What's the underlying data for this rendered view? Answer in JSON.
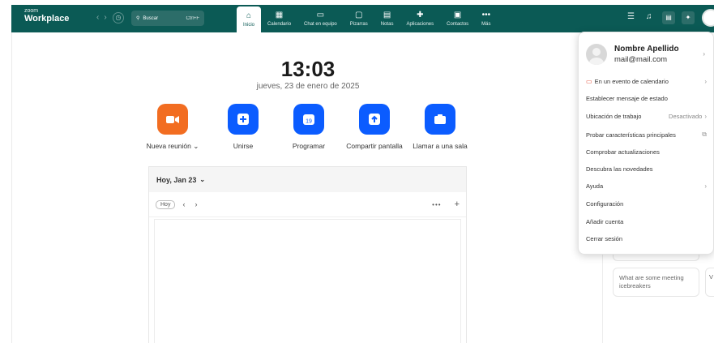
{
  "app": {
    "brand_small": "zoom",
    "brand": "Workplace"
  },
  "search": {
    "label": "Buscar",
    "shortcut": "Ctrl+F"
  },
  "tabs": [
    {
      "label": "Inicio",
      "icon": "home-icon",
      "glyph": "⌂"
    },
    {
      "label": "Calendario",
      "icon": "calendar-icon",
      "glyph": "▦"
    },
    {
      "label": "Chat en equipo",
      "icon": "chat-icon",
      "glyph": "▭"
    },
    {
      "label": "Pizarras",
      "icon": "whiteboard-icon",
      "glyph": "▢"
    },
    {
      "label": "Notas",
      "icon": "notes-icon",
      "glyph": "▤"
    },
    {
      "label": "Aplicaciones",
      "icon": "apps-icon",
      "glyph": "✚"
    },
    {
      "label": "Contactos",
      "icon": "contacts-icon",
      "glyph": "▣"
    },
    {
      "label": "Más",
      "icon": "more-icon",
      "glyph": "•••"
    }
  ],
  "clock": {
    "time": "13:03",
    "date": "jueves, 23 de enero de 2025"
  },
  "actions": [
    {
      "label": "Nueva reunión",
      "chevron": "⌄",
      "color": "#f26d21",
      "glyph": "▶"
    },
    {
      "label": "Unirse",
      "color": "#0b5cff",
      "glyph": "+"
    },
    {
      "label": "Programar",
      "color": "#0b5cff",
      "glyph": "19"
    },
    {
      "label": "Compartir pantalla",
      "color": "#0b5cff",
      "glyph": "↑"
    },
    {
      "label": "Llamar a una sala",
      "color": "#0b5cff",
      "glyph": "▬"
    }
  ],
  "calendar": {
    "header": "Hoy, Jan 23",
    "today_button": "Hoy"
  },
  "side_cards": [
    {
      "text": "What are some meeting icebreakers"
    },
    {
      "text": "V e"
    }
  ],
  "menu": {
    "name": "Nombre Apellido",
    "email": "mail@mail.com",
    "items": [
      {
        "label": "En un evento de calendario",
        "chevron": true
      },
      {
        "label": "Establecer mensaje de estado"
      },
      {
        "label": "Ubicación de trabajo",
        "value": "Desactivado",
        "chevron": true
      },
      {
        "label": "Probar características principales",
        "external": true
      },
      {
        "label": "Comprobar actualizaciones"
      },
      {
        "label": "Descubra las novedades"
      },
      {
        "label": "Ayuda",
        "chevron": true
      },
      {
        "label": "Configuración"
      },
      {
        "label": "Añadir cuenta"
      },
      {
        "label": "Cerrar sesión"
      }
    ]
  },
  "colors": {
    "topbar": "#0b5a55",
    "accent_blue": "#0b5cff",
    "accent_orange": "#f26d21"
  }
}
